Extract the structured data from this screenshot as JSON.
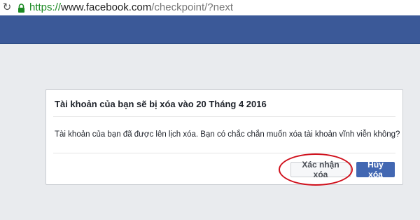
{
  "browser": {
    "url_scheme": "https://",
    "url_host": "www.facebook.com",
    "url_path": "/checkpoint/?next",
    "reload_icon": "reload-icon",
    "lock_icon": "lock-icon"
  },
  "dialog": {
    "title": "Tài khoản của bạn sẽ bị xóa vào 20 Tháng 4 2016",
    "body": "Tài khoản của bạn đã được lên lịch xóa. Bạn có chắc chắn muốn xóa tài khoản vĩnh viễn không?",
    "confirm_label": "Xác nhận xóa",
    "cancel_label": "Hủy xóa"
  },
  "colors": {
    "header": "#3b5998",
    "primary_button": "#4267b2",
    "highlight_ring": "#d0101c",
    "page_background": "#e9ebee"
  }
}
